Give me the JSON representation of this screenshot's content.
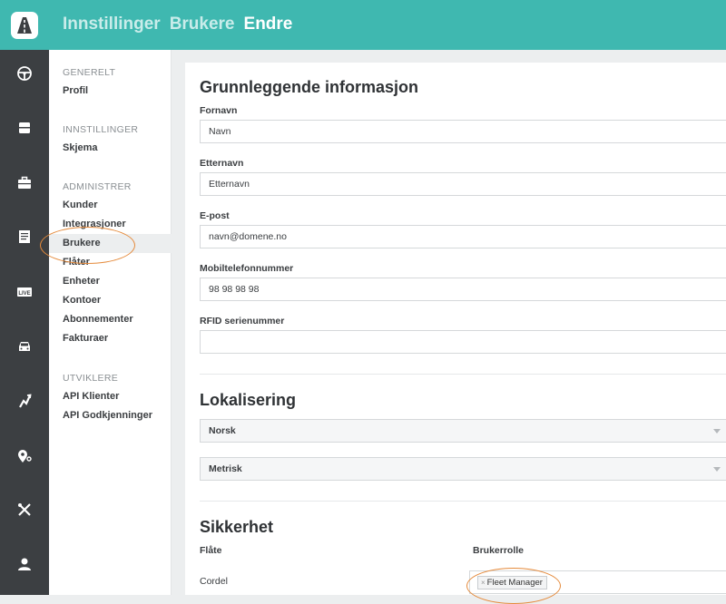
{
  "header": {
    "breadcrumb": [
      "Innstillinger",
      "Brukere",
      "Endre"
    ],
    "icon": "road-logo-icon"
  },
  "rail": {
    "icons": [
      "steering-wheel-icon",
      "inbox-icon",
      "briefcase-icon",
      "receipt-icon",
      "live-icon",
      "car-icon",
      "route-icon",
      "map-pin-icon",
      "tools-icon",
      "user-icon"
    ],
    "live_label": "LIVE"
  },
  "sidebar": {
    "sections": [
      {
        "title": "GENERELT",
        "items": [
          "Profil"
        ]
      },
      {
        "title": "INNSTILLINGER",
        "items": [
          "Skjema"
        ]
      },
      {
        "title": "ADMINISTRER",
        "items": [
          "Kunder",
          "Integrasjoner",
          "Brukere",
          "Flåter",
          "Enheter",
          "Kontoer",
          "Abonnementer",
          "Fakturaer"
        ]
      },
      {
        "title": "UTVIKLERE",
        "items": [
          "API Klienter",
          "API Godkjenninger"
        ]
      }
    ],
    "active_item": "Brukere"
  },
  "basic": {
    "heading": "Grunnleggende informasjon",
    "first_name_label": "Fornavn",
    "first_name_value": "Navn",
    "last_name_label": "Etternavn",
    "last_name_value": "Etternavn",
    "email_label": "E-post",
    "email_value": "navn@domene.no",
    "mobile_label": "Mobiltelefonnummer",
    "mobile_value": "98 98 98 98",
    "rfid_label": "RFID serienummer",
    "rfid_value": ""
  },
  "localization": {
    "heading": "Lokalisering",
    "language": "Norsk",
    "units": "Metrisk"
  },
  "security": {
    "heading": "Sikkerhet",
    "col_fleet": "Flåte",
    "col_role": "Brukerrolle",
    "rows": [
      {
        "fleet": "Cordel",
        "role_tag": "Fleet Manager",
        "tag_remove": "×"
      }
    ]
  },
  "colors": {
    "header": "#3fb8b0",
    "rail": "#3c3f42",
    "highlight": "#e58a3b"
  }
}
